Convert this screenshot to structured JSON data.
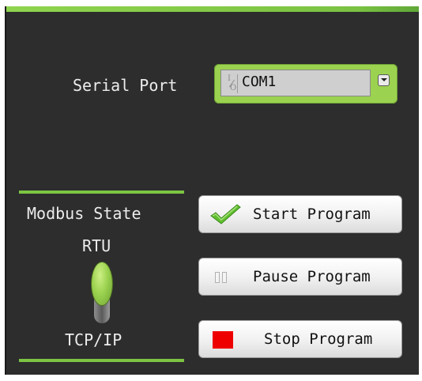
{
  "serial_port": {
    "label": "Serial Port",
    "value": "COM1",
    "icon": "io-resource-icon"
  },
  "modbus": {
    "title": "Modbus State",
    "top_option": "RTU",
    "bottom_option": "TCP/IP",
    "selected": "RTU"
  },
  "buttons": {
    "start": "Start Program",
    "pause": "Pause Program",
    "stop": "Stop Program"
  },
  "colors": {
    "accent_green": "#9bd24f",
    "panel_bg": "#2d2d2d",
    "stop_red": "#ee0000",
    "check_green": "#5fbf2e"
  }
}
